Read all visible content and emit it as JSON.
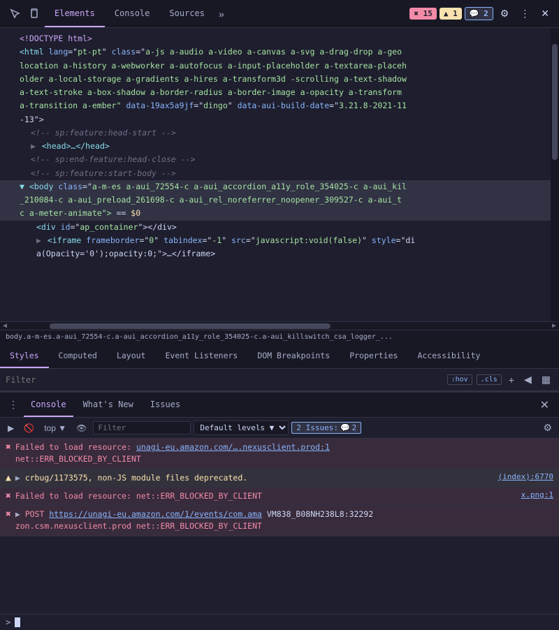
{
  "toolbar": {
    "inspect_label": "🔍",
    "device_label": "📱",
    "tabs": [
      "Elements",
      "Console",
      "Sources"
    ],
    "active_tab": "Elements",
    "more_tabs": "»",
    "badge_errors": "✖ 15",
    "badge_warnings": "▲ 1",
    "badge_chat": "💬 2",
    "settings_label": "⚙",
    "more_label": "⋮",
    "close_label": "✕"
  },
  "html_panel": {
    "lines": [
      {
        "indent": 0,
        "html": "<!DOCTYPE html>",
        "type": "doctype"
      },
      {
        "indent": 0,
        "html": "<html lang=\"pt-pt\" class=\"a-js a-audio a-video a-canvas a-svg a-drag-drop a-geo",
        "type": "tag"
      },
      {
        "indent": 0,
        "html": "location a-history a-webworker a-autofocus a-input-placeholder a-textarea-placeh",
        "type": "text"
      },
      {
        "indent": 0,
        "html": "older a-local-storage a-gradients a-hires a-transform3d -scrolling a-text-shadow",
        "type": "text"
      },
      {
        "indent": 0,
        "html": "a-text-stroke a-box-shadow a-border-radius a-border-image a-opacity a-transform",
        "type": "text"
      },
      {
        "indent": 0,
        "html": "a-transition a-ember\" data-19ax5a9jf=\"dingo\" data-aui-build-date=\"3.21.8-2021-11",
        "type": "text"
      },
      {
        "indent": 0,
        "html": "-13\">",
        "type": "text"
      },
      {
        "indent": 2,
        "html": "<!-- sp:feature:head-start -->",
        "type": "comment"
      },
      {
        "indent": 2,
        "html": "<head>…</head>",
        "type": "tag_collapsed"
      },
      {
        "indent": 2,
        "html": "<!-- sp:end-feature:head-close -->",
        "type": "comment"
      },
      {
        "indent": 2,
        "html": "<!-- sp:feature:start-body -->",
        "type": "comment"
      },
      {
        "indent": 0,
        "html": "<body class=\"a-m-es a-aui_72554-c a-aui_accordion_a11y_role_354025-c a-aui_kil",
        "type": "tag_selected",
        "selected": true
      },
      {
        "indent": 0,
        "html": "_210084-c a-aui_preload_261698-c a-aui_rel_noreferrer_noopener_309527-c a-aui_t",
        "type": "text_selected",
        "selected": true
      },
      {
        "indent": 0,
        "html": "c a-meter-animate\"> == $0",
        "type": "text_selected_dollar",
        "selected": true
      },
      {
        "indent": 4,
        "html": "<div id=\"ap_container\"></div>",
        "type": "tag"
      },
      {
        "indent": 4,
        "html": "<iframe frameborder=\"0\" tabindex=\"-1\" src=\"javascript:void(false)\" style=\"di",
        "type": "tag"
      },
      {
        "indent": 4,
        "html": "a(Opacity='0');opacity:0;\">…</iframe>",
        "type": "text"
      }
    ]
  },
  "breadcrumb": {
    "text": "body.a-m-es.a-aui_72554-c.a-aui_accordion_a11y_role_354025-c.a-aui_killswitch_csa_logger_..."
  },
  "styles_panel": {
    "tabs": [
      "Styles",
      "Computed",
      "Layout",
      "Event Listeners",
      "DOM Breakpoints",
      "Properties",
      "Accessibility"
    ],
    "active_tab": "Styles",
    "filter_placeholder": "Filter",
    "filter_hov": ":hov",
    "filter_cls": ".cls",
    "filter_plus": "+",
    "filter_arrow": "◀",
    "filter_cols": "▦"
  },
  "console_section": {
    "dots_label": "⋮",
    "tabs": [
      "Console",
      "What's New",
      "Issues"
    ],
    "active_tab": "Console",
    "close_label": "✕",
    "toolbar": {
      "play_label": "▶",
      "block_label": "🚫",
      "context_label": "top",
      "context_arrow": "▼",
      "eye_label": "👁",
      "filter_placeholder": "Filter",
      "level_label": "Default levels",
      "level_arrow": "▼",
      "issues_label": "2 Issues:",
      "issues_icon": "💬",
      "issues_count": "2",
      "gear_label": "⚙"
    },
    "messages": [
      {
        "type": "error",
        "icon": "✖",
        "text_parts": [
          {
            "type": "red",
            "text": "Failed to load resource:"
          },
          {
            "type": "normal",
            "text": " "
          },
          {
            "type": "link",
            "text": "unagi-eu.amazon.com/….nexusclient.prod:1"
          }
        ],
        "second_line": "net::ERR_BLOCKED_BY_CLIENT",
        "source": null
      },
      {
        "type": "warning",
        "icon": "▲",
        "arrow": "▶",
        "text_parts": [
          {
            "type": "warn",
            "text": "crbug/1173575, non-JS module files deprecated."
          }
        ],
        "source": "(index):6770"
      },
      {
        "type": "error",
        "icon": "✖",
        "text_parts": [
          {
            "type": "red",
            "text": "Failed to load resource: net::ERR_BLOCKED_BY_CLIENT"
          }
        ],
        "source": "x.png:1"
      },
      {
        "type": "error",
        "icon": "✖",
        "arrow": "▶",
        "text_parts": [
          {
            "type": "red",
            "text": "▶ POST "
          },
          {
            "type": "link",
            "text": "https://unagi-eu.amazon.com/1/events/com.ama"
          },
          {
            "type": "normal",
            "text": " VM838_B08NH238L8:32292"
          }
        ],
        "second_line": "zon.csm.nexusclient.prod net::ERR_BLOCKED_BY_CLIENT",
        "source": null
      }
    ],
    "input_prompt": ">"
  },
  "colors": {
    "bg_primary": "#1e1e2e",
    "bg_secondary": "#181825",
    "accent": "#cba6f7",
    "error": "#f38ba8",
    "warning": "#f9e2af",
    "link": "#89b4fa",
    "selected_bg": "#313244"
  }
}
